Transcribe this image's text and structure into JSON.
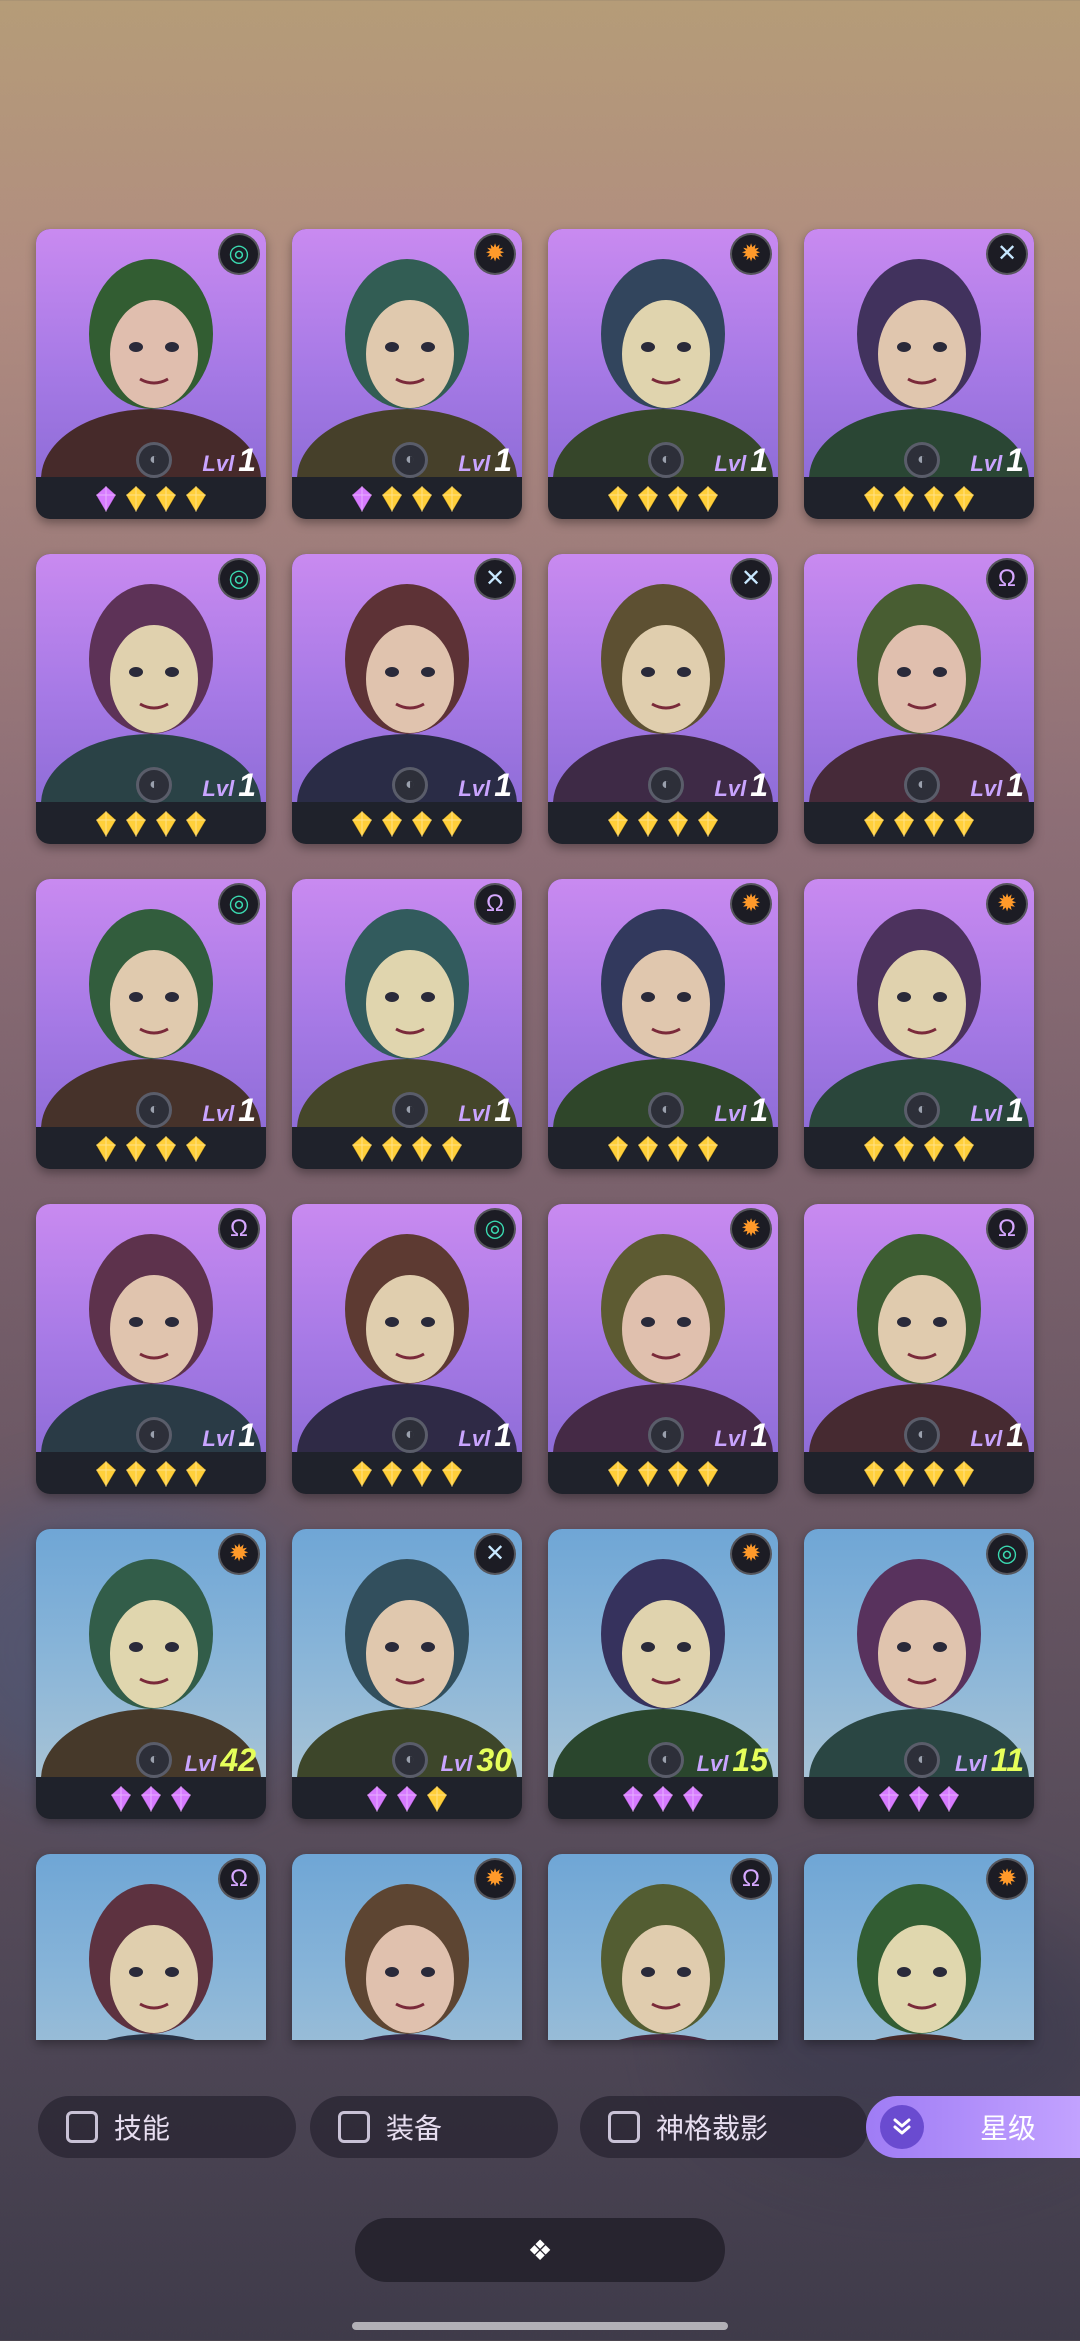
{
  "cards": [
    {
      "faction": "swirl",
      "bg": "purple",
      "level": "1",
      "gems": [
        "purple",
        "gold",
        "gold",
        "gold"
      ]
    },
    {
      "faction": "sun",
      "bg": "purple",
      "level": "1",
      "gems": [
        "purple",
        "gold",
        "gold",
        "gold"
      ]
    },
    {
      "faction": "sun",
      "bg": "purple",
      "level": "1",
      "gems": [
        "gold",
        "gold",
        "gold",
        "gold"
      ]
    },
    {
      "faction": "cross",
      "bg": "purple",
      "level": "1",
      "gems": [
        "gold",
        "gold",
        "gold",
        "gold"
      ]
    },
    {
      "faction": "swirl",
      "bg": "purple",
      "level": "1",
      "gems": [
        "gold",
        "gold",
        "gold",
        "gold"
      ]
    },
    {
      "faction": "cross",
      "bg": "purple",
      "level": "1",
      "gems": [
        "gold",
        "gold",
        "gold",
        "gold"
      ]
    },
    {
      "faction": "cross",
      "bg": "purple",
      "level": "1",
      "gems": [
        "gold",
        "gold",
        "gold",
        "gold"
      ]
    },
    {
      "faction": "omega",
      "bg": "purple",
      "level": "1",
      "gems": [
        "gold",
        "gold",
        "gold",
        "gold"
      ]
    },
    {
      "faction": "swirl",
      "bg": "purple",
      "level": "1",
      "gems": [
        "gold",
        "gold",
        "gold",
        "gold"
      ]
    },
    {
      "faction": "omega",
      "bg": "purple",
      "level": "1",
      "gems": [
        "gold",
        "gold",
        "gold",
        "gold"
      ]
    },
    {
      "faction": "sun",
      "bg": "purple",
      "level": "1",
      "gems": [
        "gold",
        "gold",
        "gold",
        "gold"
      ]
    },
    {
      "faction": "sun",
      "bg": "purple",
      "level": "1",
      "gems": [
        "gold",
        "gold",
        "gold",
        "gold"
      ]
    },
    {
      "faction": "omega",
      "bg": "purple",
      "level": "1",
      "gems": [
        "gold",
        "gold",
        "gold",
        "gold"
      ]
    },
    {
      "faction": "swirl",
      "bg": "purple",
      "level": "1",
      "gems": [
        "gold",
        "gold",
        "gold",
        "gold"
      ]
    },
    {
      "faction": "sun",
      "bg": "purple",
      "level": "1",
      "gems": [
        "gold",
        "gold",
        "gold",
        "gold"
      ]
    },
    {
      "faction": "omega",
      "bg": "purple",
      "level": "1",
      "gems": [
        "gold",
        "gold",
        "gold",
        "gold"
      ]
    },
    {
      "faction": "sun",
      "bg": "blue",
      "level": "42",
      "gems": [
        "purple",
        "purple",
        "purple"
      ]
    },
    {
      "faction": "cross",
      "bg": "blue",
      "level": "30",
      "gems": [
        "purple",
        "purple",
        "gold"
      ]
    },
    {
      "faction": "sun",
      "bg": "blue",
      "level": "15",
      "gems": [
        "purple",
        "purple",
        "purple"
      ]
    },
    {
      "faction": "swirl",
      "bg": "blue",
      "level": "11",
      "gems": [
        "purple",
        "purple",
        "purple"
      ]
    },
    {
      "faction": "omega",
      "bg": "blue",
      "level": "",
      "gems": [],
      "cut": true
    },
    {
      "faction": "sun",
      "bg": "blue",
      "level": "",
      "gems": [],
      "cut": true
    },
    {
      "faction": "omega",
      "bg": "blue",
      "level": "",
      "gems": [],
      "cut": true
    },
    {
      "faction": "sun",
      "bg": "blue",
      "level": "",
      "gems": [],
      "cut": true
    }
  ],
  "level_prefix": "Lvl",
  "filters": {
    "skill": "技能",
    "equipment": "装备",
    "divine": "神格裁影",
    "star": "星级"
  },
  "bottom_button_glyph": "❖",
  "colors": {
    "gem_purple": "#d77bff",
    "gem_gold": "#ffcf3a",
    "accent": "#9f7cf5"
  }
}
